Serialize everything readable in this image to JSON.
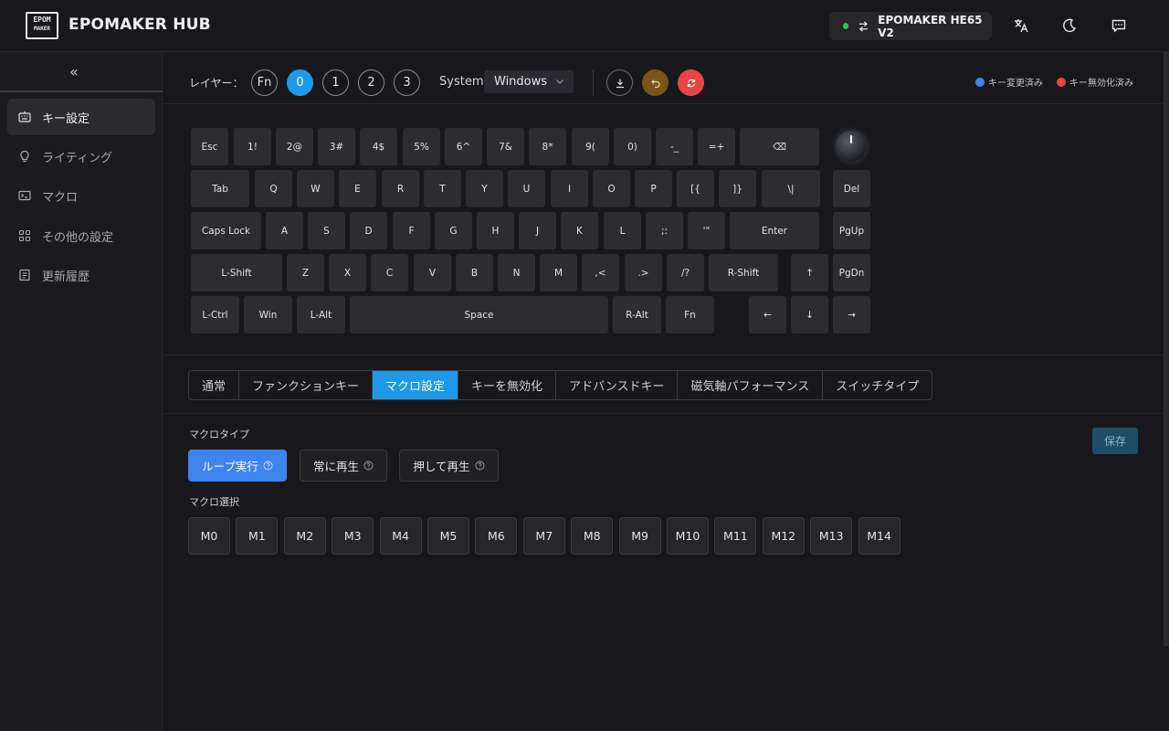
{
  "header": {
    "logo_line1": "EPOM",
    "logo_line2": "MAKER",
    "app_title": "EPOMAKER HUB",
    "device_name": "EPOMAKER HE65 V2",
    "status_color": "#2fc25b"
  },
  "sidebar": {
    "collapse": "«",
    "items": [
      {
        "label": "キー設定",
        "icon": "keyboard-icon",
        "active": true
      },
      {
        "label": "ライティング",
        "icon": "bulb-icon"
      },
      {
        "label": "マクロ",
        "icon": "terminal-icon"
      },
      {
        "label": "その他の設定",
        "icon": "grid-icon"
      },
      {
        "label": "更新履歴",
        "icon": "document-icon"
      }
    ]
  },
  "toolbar": {
    "layer_label": "レイヤー：",
    "layers": [
      "Fn",
      "0",
      "1",
      "2",
      "3"
    ],
    "active_layer": "0",
    "system_label": "System",
    "system_value": "Windows",
    "legend_changed": "キー変更済み",
    "legend_disabled": "キー無効化済み",
    "legend_changed_color": "#3d84f0",
    "legend_disabled_color": "#e84545"
  },
  "keyboard": {
    "rows": [
      [
        "Esc",
        "1!",
        "2@",
        "3#",
        "4$",
        "5%",
        "6^",
        "7&",
        "8*",
        "9(",
        "0)",
        "-_",
        "=+",
        "⌫"
      ],
      [
        "Tab",
        "Q",
        "W",
        "E",
        "R",
        "T",
        "Y",
        "U",
        "I",
        "O",
        "P",
        "[{",
        "]}",
        "\\|",
        "Del"
      ],
      [
        "Caps Lock",
        "A",
        "S",
        "D",
        "F",
        "G",
        "H",
        "J",
        "K",
        "L",
        ";:",
        "'\"",
        "Enter",
        "PgUp"
      ],
      [
        "L-Shift",
        "Z",
        "X",
        "C",
        "V",
        "B",
        "N",
        "M",
        ",<",
        ".>",
        "/?",
        "R-Shift",
        "↑",
        "PgDn"
      ],
      [
        "L-Ctrl",
        "Win",
        "L-Alt",
        "Space",
        "R-Alt",
        "Fn",
        "←",
        "↓",
        "→"
      ]
    ]
  },
  "tabs": [
    "通常",
    "ファンクションキー",
    "マクロ設定",
    "キーを無効化",
    "アドバンスドキー",
    "磁気軸パフォーマンス",
    "スイッチタイプ"
  ],
  "active_tab": "マクロ設定",
  "macro": {
    "type_label": "マクロタイプ",
    "types": [
      "ループ実行",
      "常に再生",
      "押して再生"
    ],
    "active_type": "ループ実行",
    "select_label": "マクロ選択",
    "slots": [
      "M0",
      "M1",
      "M2",
      "M3",
      "M4",
      "M5",
      "M6",
      "M7",
      "M8",
      "M9",
      "M10",
      "M11",
      "M12",
      "M13",
      "M14"
    ],
    "save_label": "保存"
  }
}
